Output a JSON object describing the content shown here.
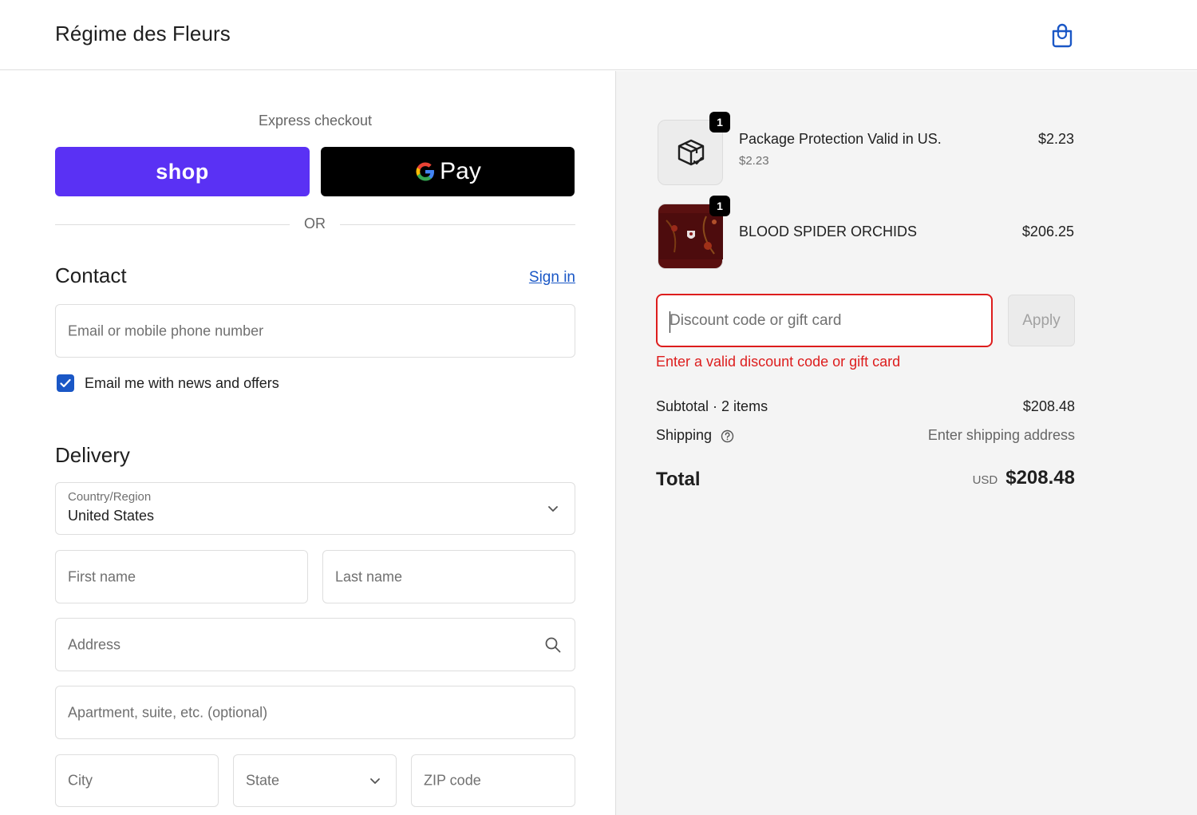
{
  "header": {
    "brand": "Régime des Fleurs",
    "cart_icon": "shopping-bag-icon"
  },
  "express": {
    "label": "Express checkout",
    "shop_label": "shop",
    "gpay_label": "Pay",
    "or_label": "OR",
    "shop_color": "#5a31f4"
  },
  "contact": {
    "heading": "Contact",
    "signin_label": "Sign in",
    "email_placeholder": "Email or mobile phone number",
    "newsletter_label": "Email me with news and offers",
    "newsletter_checked": true
  },
  "delivery": {
    "heading": "Delivery",
    "country_label": "Country/Region",
    "country_value": "United States",
    "first_name_placeholder": "First name",
    "last_name_placeholder": "Last name",
    "address_placeholder": "Address",
    "apartment_placeholder": "Apartment, suite, etc. (optional)",
    "city_placeholder": "City",
    "state_placeholder": "State",
    "zip_placeholder": "ZIP code"
  },
  "order": {
    "items": [
      {
        "name": "Package Protection Valid in US.",
        "subtitle": "$2.23",
        "price": "$2.23",
        "quantity": "1",
        "icon": "package-check-icon"
      },
      {
        "name": "BLOOD SPIDER ORCHIDS",
        "subtitle": "",
        "price": "$206.25",
        "quantity": "1",
        "icon": "product-image"
      }
    ],
    "discount_placeholder": "Discount code or gift card",
    "apply_label": "Apply",
    "discount_error": "Enter a valid discount code or gift card",
    "subtotal_label": "Subtotal · 2 items",
    "subtotal_value": "$208.48",
    "shipping_label": "Shipping",
    "shipping_value": "Enter shipping address",
    "total_label": "Total",
    "total_currency": "USD",
    "total_value": "$208.48",
    "error_color": "#dd1d1d",
    "link_color": "#1a57c6"
  }
}
